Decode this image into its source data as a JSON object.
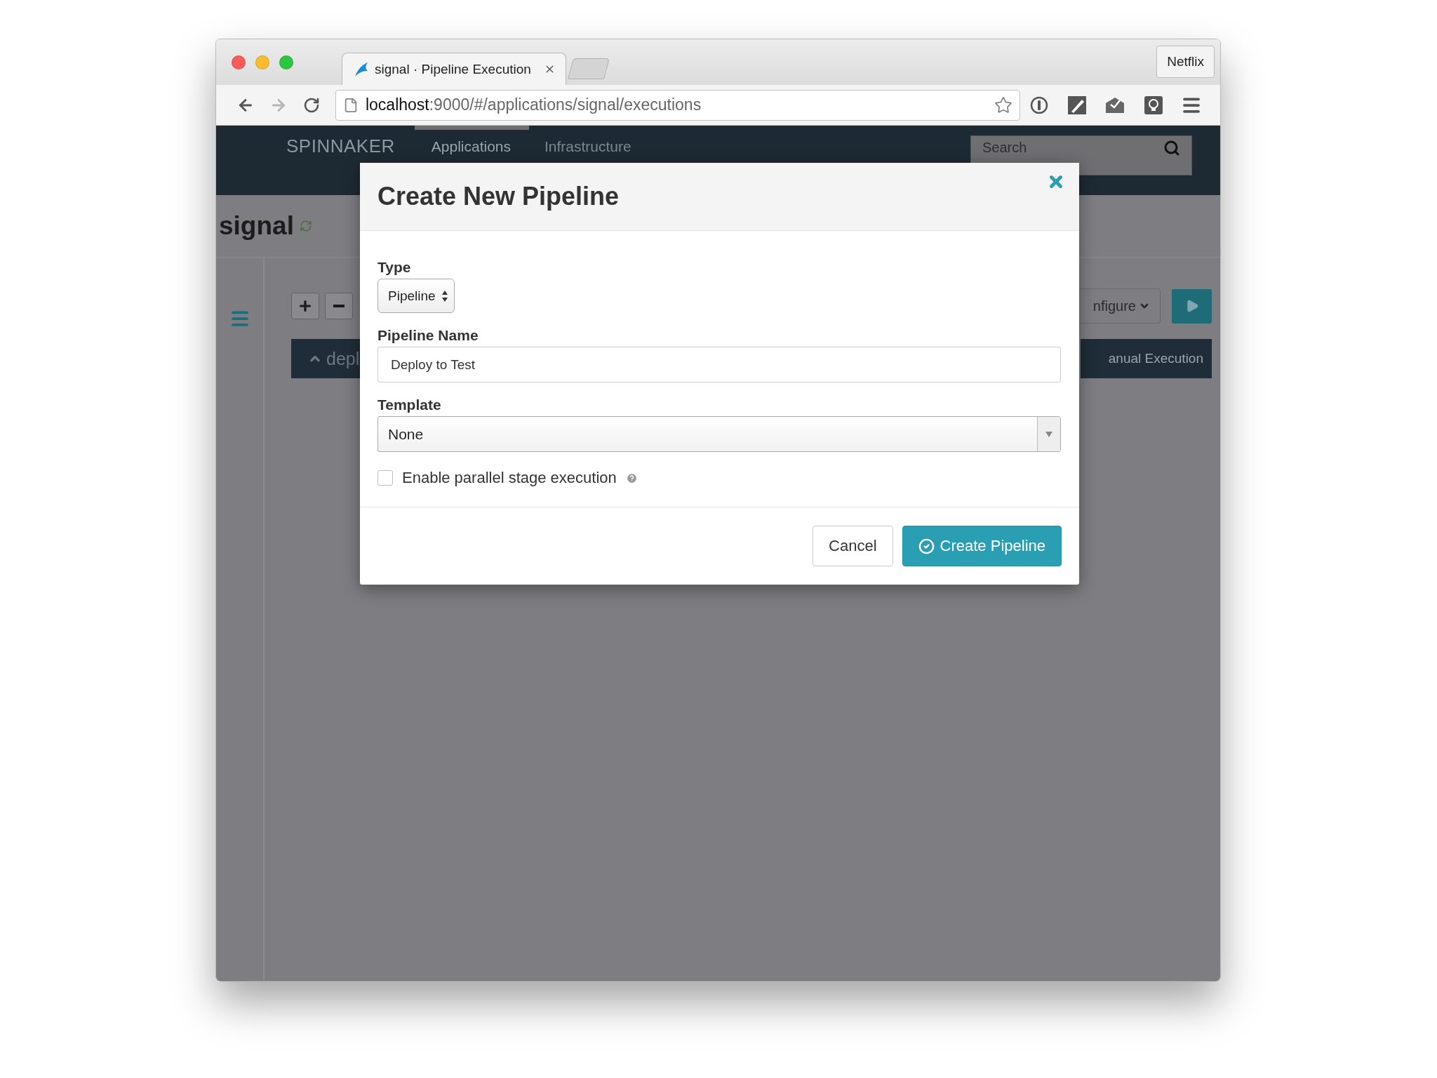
{
  "browser": {
    "tabs": [
      {
        "title": "signal · Pipeline Execution",
        "selected": true
      }
    ],
    "profile_button": "Netflix",
    "url": {
      "host": "localhost",
      "path": ":9000/#/applications/signal/executions"
    }
  },
  "nav": {
    "brand": "SPINNAKER",
    "links": [
      {
        "label": "Applications",
        "selected": true
      },
      {
        "label": "Infrastructure",
        "selected": false
      }
    ],
    "search": {
      "placeholder": "Search"
    }
  },
  "app": {
    "title": "signal",
    "group_label": "depl",
    "configure_label": "nfigure",
    "manual_label": "anual Execution"
  },
  "dialog": {
    "title": "Create New Pipeline",
    "type": {
      "label": "Type",
      "value": "Pipeline"
    },
    "name": {
      "label": "Pipeline Name",
      "value": "Deploy to Test"
    },
    "template": {
      "label": "Template",
      "value": "None"
    },
    "parallel": {
      "label": "Enable parallel stage execution",
      "checked": false
    },
    "cancel": "Cancel",
    "submit": "Create Pipeline"
  }
}
